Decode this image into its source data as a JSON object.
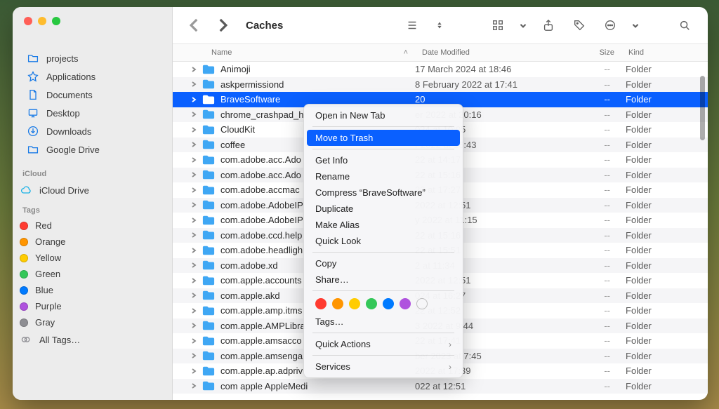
{
  "window": {
    "title": "Caches"
  },
  "sidebar": {
    "favorites": [
      {
        "label": "projects",
        "icon": "folder-icon"
      },
      {
        "label": "Applications",
        "icon": "apps-icon"
      },
      {
        "label": "Documents",
        "icon": "doc-icon"
      },
      {
        "label": "Desktop",
        "icon": "desktop-icon"
      },
      {
        "label": "Downloads",
        "icon": "downloads-icon"
      },
      {
        "label": "Google Drive",
        "icon": "folder-icon"
      }
    ],
    "icloud_hdr": "iCloud",
    "icloud": [
      {
        "label": "iCloud Drive",
        "icon": "cloud-icon"
      }
    ],
    "tags_hdr": "Tags",
    "tags": [
      {
        "label": "Red",
        "color": "#ff3b30"
      },
      {
        "label": "Orange",
        "color": "#ff9500"
      },
      {
        "label": "Yellow",
        "color": "#ffcc00"
      },
      {
        "label": "Green",
        "color": "#34c759"
      },
      {
        "label": "Blue",
        "color": "#007aff"
      },
      {
        "label": "Purple",
        "color": "#af52de"
      },
      {
        "label": "Gray",
        "color": "#8e8e93"
      }
    ],
    "all_tags": "All Tags…"
  },
  "columns": {
    "name": "Name",
    "date": "Date Modified",
    "size": "Size",
    "kind": "Kind"
  },
  "rows": [
    {
      "name": "Animoji",
      "date": "17 March 2024 at 18:46",
      "size": "--",
      "kind": "Folder",
      "sel": false
    },
    {
      "name": "askpermissiond",
      "date": "8 February 2022 at 17:41",
      "size": "--",
      "kind": "Folder",
      "sel": false
    },
    {
      "name": "BraveSoftware",
      "date": "20",
      "size": "--",
      "kind": "Folder",
      "sel": true
    },
    {
      "name": "chrome_crashpad_h",
      "date": "er 2022 at 20:16",
      "size": "--",
      "kind": "Folder",
      "sel": false
    },
    {
      "name": "CloudKit",
      "date": "024 at 10:05",
      "size": "--",
      "kind": "Folder",
      "sel": false
    },
    {
      "name": "coffee",
      "date": "r 2022 at 16:43",
      "size": "--",
      "kind": "Folder",
      "sel": false
    },
    {
      "name": "com.adobe.acc.Ado",
      "date": "22 at 14:17",
      "size": "--",
      "kind": "Folder",
      "sel": false
    },
    {
      "name": "com.adobe.acc.Ado",
      "date": "22 at 15:16",
      "size": "--",
      "kind": "Folder",
      "sel": false
    },
    {
      "name": "com.adobe.accmac",
      "date": "22 at 17:27",
      "size": "--",
      "kind": "Folder",
      "sel": false
    },
    {
      "name": "com.adobe.AdobeIP",
      "date": "2022 at 12:51",
      "size": "--",
      "kind": "Folder",
      "sel": false
    },
    {
      "name": "com.adobe.AdobeIP",
      "date": "y 2022 at 11:15",
      "size": "--",
      "kind": "Folder",
      "sel": false
    },
    {
      "name": "com.adobe.ccd.help",
      "date": "22 at 15:16",
      "size": "--",
      "kind": "Folder",
      "sel": false
    },
    {
      "name": "com.adobe.headligh",
      "date": "22 at 15:51",
      "size": "--",
      "kind": "Folder",
      "sel": false
    },
    {
      "name": "com.adobe.xd",
      "date": "2 at 11:34",
      "size": "--",
      "kind": "Folder",
      "sel": false
    },
    {
      "name": "com.apple.accounts",
      "date": "2022 at 12:51",
      "size": "--",
      "kind": "Folder",
      "sel": false
    },
    {
      "name": "com.apple.akd",
      "date": "024 at 16:27",
      "size": "--",
      "kind": "Folder",
      "sel": false
    },
    {
      "name": "com.apple.amp.itms",
      "date": "22 at 12:52",
      "size": "--",
      "kind": "Folder",
      "sel": false
    },
    {
      "name": "com.apple.AMPLibra",
      "date": "3 2022 at 9:44",
      "size": "--",
      "kind": "Folder",
      "sel": false
    },
    {
      "name": "com.apple.amsacco",
      "date": "22 at 17:41",
      "size": "--",
      "kind": "Folder",
      "sel": false
    },
    {
      "name": "com.apple.amsenga",
      "date": "ber 2023 at 7:45",
      "size": "--",
      "kind": "Folder",
      "sel": false
    },
    {
      "name": "com.apple.ap.adpriv",
      "date": "2022 at 17:39",
      "size": "--",
      "kind": "Folder",
      "sel": false
    },
    {
      "name": "com apple AppleMedi",
      "date": "022 at 12:51",
      "size": "--",
      "kind": "Folder",
      "sel": false
    }
  ],
  "ctx": {
    "open_tab": "Open in New Tab",
    "trash": "Move to Trash",
    "getinfo": "Get Info",
    "rename": "Rename",
    "compress": "Compress “BraveSoftware”",
    "duplicate": "Duplicate",
    "alias": "Make Alias",
    "quicklook": "Quick Look",
    "copy": "Copy",
    "share": "Share…",
    "tags": "Tags…",
    "quickact": "Quick Actions",
    "services": "Services",
    "tag_colors": [
      "#ff3b30",
      "#ff9500",
      "#ffcc00",
      "#34c759",
      "#007aff",
      "#af52de"
    ]
  }
}
